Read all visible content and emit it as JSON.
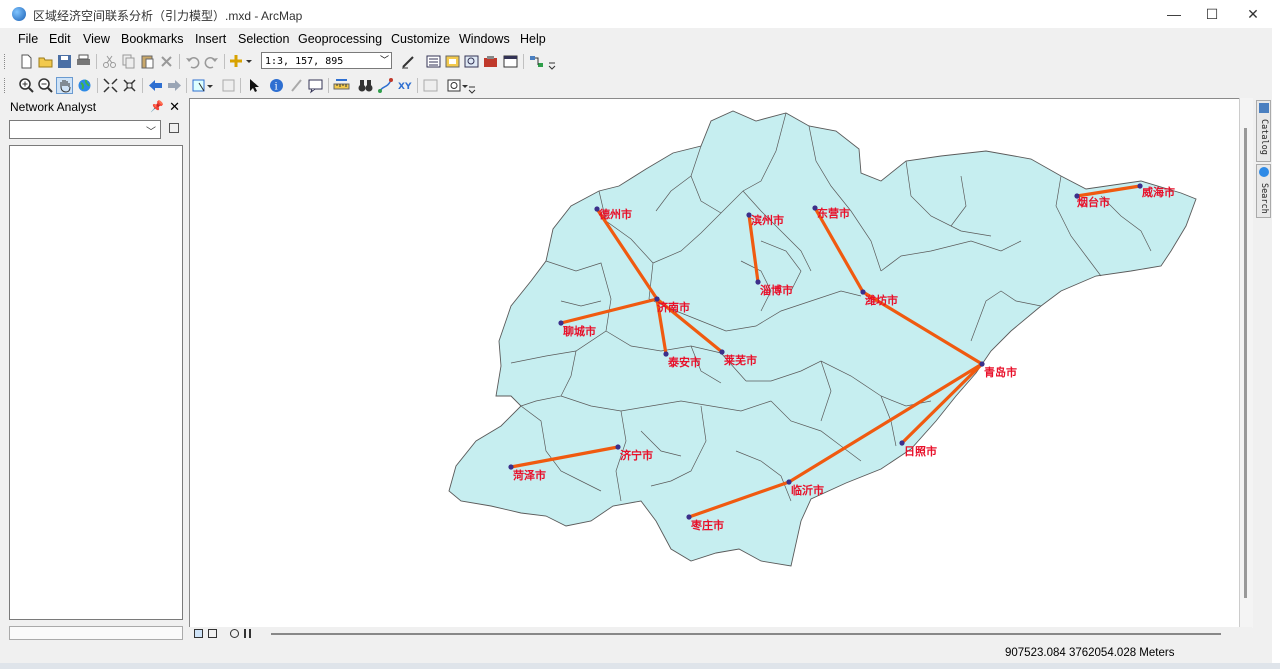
{
  "window": {
    "title": "区域经济空间联系分析（引力模型）.mxd - ArcMap",
    "minimize": "—",
    "maximize": "☐",
    "close": "✕"
  },
  "menu": [
    "File",
    "Edit",
    "View",
    "Bookmarks",
    "Insert",
    "Selection",
    "Geoprocessing",
    "Customize",
    "Windows",
    "Help"
  ],
  "toolbar": {
    "scale": "1:3, 157, 895"
  },
  "panel": {
    "title": "Network Analyst",
    "pin": "ᵖ",
    "close": "✕"
  },
  "side_tabs": [
    "Catalog",
    "Search"
  ],
  "status": {
    "coords": "907523.084  3762054.028 Meters"
  },
  "colors": {
    "province_fill": "#c6eef0",
    "boundary": "#5a5a5a",
    "link_line": "#f05a10",
    "city_point": "#3c2f8a",
    "label": "#e8102a"
  },
  "cities": [
    {
      "name": "德州市"
    },
    {
      "name": "滨州市"
    },
    {
      "name": "东营市"
    },
    {
      "name": "烟台市"
    },
    {
      "name": "威海市"
    },
    {
      "name": "济南市"
    },
    {
      "name": "淄博市"
    },
    {
      "name": "潍坊市"
    },
    {
      "name": "聊城市"
    },
    {
      "name": "泰安市"
    },
    {
      "name": "莱芜市"
    },
    {
      "name": "青岛市"
    },
    {
      "name": "济宁市"
    },
    {
      "name": "菏泽市"
    },
    {
      "name": "日照市"
    },
    {
      "name": "临沂市"
    },
    {
      "name": "枣庄市"
    }
  ],
  "links": [
    [
      "德州市",
      "济南市"
    ],
    [
      "聊城市",
      "济南市"
    ],
    [
      "济南市",
      "泰安市"
    ],
    [
      "济南市",
      "莱芜市"
    ],
    [
      "滨州市",
      "淄博市"
    ],
    [
      "东营市",
      "潍坊市"
    ],
    [
      "潍坊市",
      "青岛市"
    ],
    [
      "烟台市",
      "威海市"
    ],
    [
      "青岛市",
      "日照市"
    ],
    [
      "青岛市",
      "临沂市"
    ],
    [
      "临沂市",
      "枣庄市"
    ],
    [
      "菏泽市",
      "济宁市"
    ]
  ]
}
